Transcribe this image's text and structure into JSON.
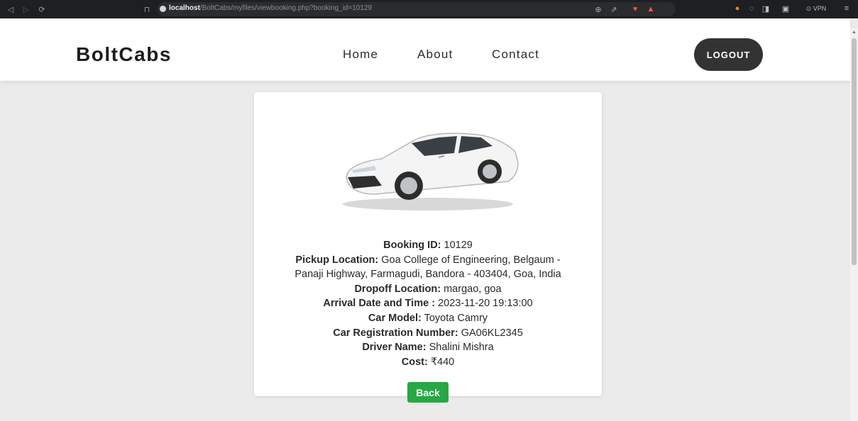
{
  "browser": {
    "url_host": "localhost",
    "url_path": "/BoltCabs/myfiles/viewbooking.php?booking_id=10129",
    "vpn_label": "VPN"
  },
  "header": {
    "brand": "BoltCabs",
    "nav": [
      "Home",
      "About",
      "Contact"
    ],
    "logout_label": "LOGOUT"
  },
  "booking": {
    "fields": [
      {
        "label": "Booking ID:",
        "value": " 10129"
      },
      {
        "label": "Pickup Location:",
        "value": " Goa College of Engineering, Belgaum - Panaji Highway, Farmagudi, Bandora - 403404, Goa, India"
      },
      {
        "label": "Dropoff Location:",
        "value": " margao, goa"
      },
      {
        "label": "Arrival Date and Time :",
        "value": " 2023-11-20 19:13:00"
      },
      {
        "label": "Car Model:",
        "value": " Toyota Camry"
      },
      {
        "label": "Car Registration Number:",
        "value": " GA06KL2345"
      },
      {
        "label": "Driver Name:",
        "value": " Shalini Mishra"
      },
      {
        "label": "Cost:",
        "value": " ₹440"
      }
    ],
    "back_label": "Back"
  },
  "colors": {
    "back_button": "#28a745",
    "logout_button": "#333333",
    "browser_bar": "#1e1f22"
  }
}
